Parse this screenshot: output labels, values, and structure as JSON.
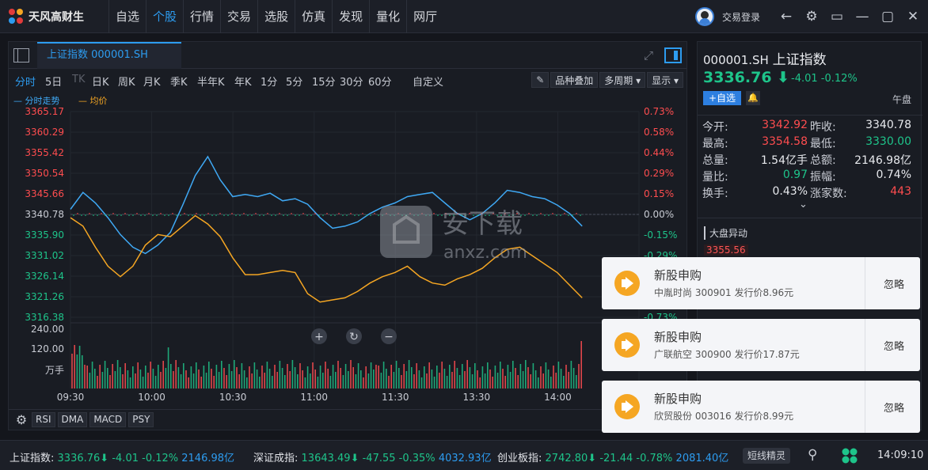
{
  "app": {
    "title": "天风高财生"
  },
  "nav": [
    "自选",
    "个股",
    "行情",
    "交易",
    "选股",
    "仿真",
    "发现",
    "量化",
    "网厅"
  ],
  "nav_active": "个股",
  "topbar": {
    "login": "交易登录"
  },
  "chart_tab": {
    "label": "上证指数 000001.SH"
  },
  "periods": [
    "分时",
    "5日",
    "TK",
    "日K",
    "周K",
    "月K",
    "季K",
    "半年K",
    "年K",
    "1分",
    "5分",
    "15分",
    "30分",
    "60分",
    "自定义"
  ],
  "period_active": "分时",
  "chart_tools": {
    "overlay": "品种叠加",
    "multi": "多周期",
    "display": "显示"
  },
  "legend": {
    "line1": "分时走势",
    "line2": "均价"
  },
  "indicators": [
    "RSI",
    "DMA",
    "MACD",
    "PSY"
  ],
  "chart_data": {
    "type": "line",
    "y_labels_left": [
      "3365.17",
      "3360.29",
      "3355.42",
      "3350.54",
      "3345.66",
      "3340.78",
      "3335.90",
      "3331.02",
      "3326.14",
      "3321.26",
      "3316.38"
    ],
    "y_labels_right": [
      "0.73%",
      "0.58%",
      "0.44%",
      "0.29%",
      "0.15%",
      "0.00%",
      "-0.15%",
      "-0.29%",
      "-0.44%",
      "-0.58%",
      "-0.73%"
    ],
    "volume_labels": [
      "240.00",
      "120.00",
      "万手"
    ],
    "x_labels": [
      "09:30",
      "10:00",
      "10:30",
      "11:00",
      "11:30",
      "13:30",
      "14:00",
      "14:30"
    ],
    "ylim": [
      3316.38,
      3365.17
    ],
    "prev_close": 3340.78,
    "series": [
      {
        "name": "分时走势",
        "color": "#3fa9f5",
        "values": [
          3342.0,
          3346.0,
          3343.5,
          3340.0,
          3336.0,
          3333.0,
          3331.5,
          3333.5,
          3336.5,
          3343.0,
          3350.0,
          3354.5,
          3349.0,
          3345.0,
          3345.5,
          3345.0,
          3345.8,
          3344.0,
          3344.5,
          3343.2,
          3340.0,
          3337.5,
          3338.0,
          3339.0,
          3341.0,
          3342.5,
          3343.5,
          3345.0,
          3345.5,
          3346.0,
          3343.5,
          3341.0,
          3339.5,
          3341.0,
          3343.5,
          3346.5,
          3346.0,
          3345.0,
          3344.5,
          3343.0,
          3341.0,
          3338.0
        ]
      },
      {
        "name": "均价",
        "color": "#f5a623",
        "values": [
          3340.0,
          3338.0,
          3333.0,
          3328.5,
          3326.0,
          3328.5,
          3333.5,
          3336.0,
          3335.5,
          3338.0,
          3340.5,
          3338.5,
          3335.5,
          3330.5,
          3326.5,
          3326.5,
          3327.0,
          3327.5,
          3327.0,
          3322.0,
          3320.0,
          3320.5,
          3321.0,
          3322.5,
          3324.5,
          3326.0,
          3327.0,
          3328.5,
          3326.0,
          3324.5,
          3324.0,
          3325.5,
          3326.5,
          3328.0,
          3330.5,
          3332.5,
          3333.0,
          3331.0,
          3329.0,
          3327.0,
          3324.0,
          3321.0
        ]
      }
    ]
  },
  "quote": {
    "code": "000001.SH",
    "name": "上证指数",
    "price": "3336.76",
    "change": "-4.01",
    "pct": "-0.12%",
    "add_btn": "+自选",
    "session": "午盘",
    "stats": [
      {
        "l1": "今开:",
        "v1": "3342.92",
        "c1": "#ff4d4f",
        "l2": "昨收:",
        "v2": "3340.78",
        "c2": "#e8eaee"
      },
      {
        "l1": "最高:",
        "v1": "3354.58",
        "c1": "#ff4d4f",
        "l2": "最低:",
        "v2": "3330.00",
        "c2": "#1ec48a"
      },
      {
        "l1": "总量:",
        "v1": "1.54亿手",
        "c1": "#e8eaee",
        "l2": "总额:",
        "v2": "2146.98亿",
        "c2": "#e8eaee"
      },
      {
        "l1": "量比:",
        "v1": "0.97",
        "c1": "#1ec48a",
        "l2": "振幅:",
        "v2": "0.74%",
        "c2": "#e8eaee"
      },
      {
        "l1": "换手:",
        "v1": "0.43%",
        "c1": "#e8eaee",
        "l2": "涨家数:",
        "v2": "443",
        "c2": "#ff4d4f"
      }
    ],
    "anomaly_title": "大盘异动",
    "anomaly_price": "3355.56"
  },
  "toasts": [
    {
      "title": "新股申购",
      "body": "中胤时尚 300901 发行价8.96元",
      "ignore": "忽略"
    },
    {
      "title": "新股申购",
      "body": "广联航空 300900 发行价17.87元",
      "ignore": "忽略"
    },
    {
      "title": "新股申购",
      "body": "欣贸股份 003016 发行价8.99元",
      "ignore": "忽略"
    }
  ],
  "statusbar": {
    "sh": {
      "name": "上证指数:",
      "price": "3336.76",
      "chg": "-4.01",
      "pct": "-0.12%",
      "amt": "2146.98亿"
    },
    "sz": {
      "name": "深证成指:",
      "price": "13643.49",
      "chg": "-47.55",
      "pct": "-0.35%",
      "amt": "4032.93亿"
    },
    "cy": {
      "name": "创业板指:",
      "price": "2742.80",
      "chg": "-21.44",
      "pct": "-0.78%",
      "amt": "2081.40亿"
    },
    "short_btn": "短线精灵",
    "clock": "14:09:10"
  },
  "watermark": {
    "cn": "安下载",
    "en": "anxz.com"
  }
}
